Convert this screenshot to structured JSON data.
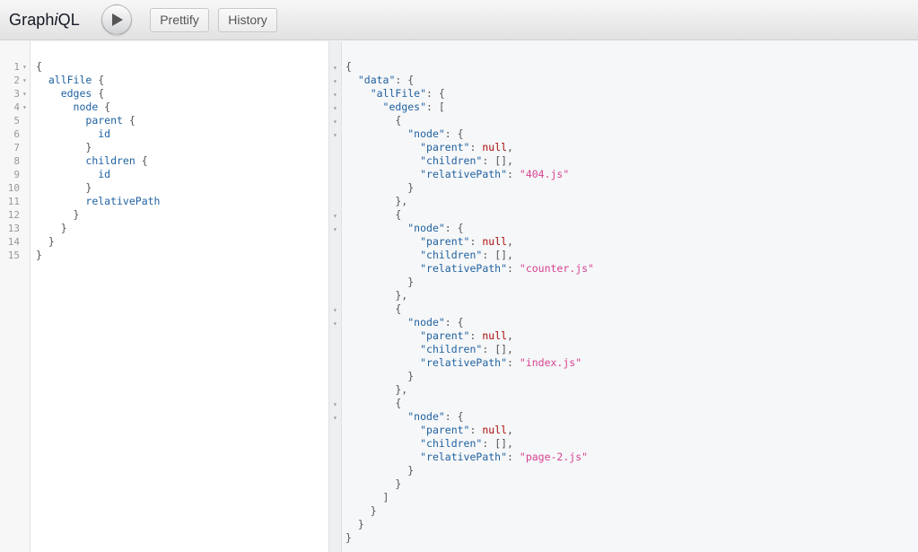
{
  "app": {
    "title_prefix": "Graph",
    "title_italic": "i",
    "title_suffix": "QL"
  },
  "toolbar": {
    "run_icon": "play-icon",
    "prettify_label": "Prettify",
    "history_label": "History"
  },
  "query_editor": {
    "line_numbers": [
      "1",
      "2",
      "3",
      "4",
      "5",
      "6",
      "7",
      "8",
      "9",
      "10",
      "11",
      "12",
      "13",
      "14",
      "15"
    ],
    "lines": [
      "{",
      "  allFile {",
      "    edges {",
      "      node {",
      "        parent {",
      "          id",
      "        }",
      "        children {",
      "          id",
      "        }",
      "        relativePath",
      "      }",
      "    }",
      "  }",
      "}"
    ]
  },
  "result": {
    "lines": [
      "{",
      "  \"data\": {",
      "    \"allFile\": {",
      "      \"edges\": [",
      "        {",
      "          \"node\": {",
      "            \"parent\": null,",
      "            \"children\": [],",
      "            \"relativePath\": \"404.js\"",
      "          }",
      "        },",
      "        {",
      "          \"node\": {",
      "            \"parent\": null,",
      "            \"children\": [],",
      "            \"relativePath\": \"counter.js\"",
      "          }",
      "        },",
      "        {",
      "          \"node\": {",
      "            \"parent\": null,",
      "            \"children\": [],",
      "            \"relativePath\": \"index.js\"",
      "          }",
      "        },",
      "        {",
      "          \"node\": {",
      "            \"parent\": null,",
      "            \"children\": [],",
      "            \"relativePath\": \"page-2.js\"",
      "          }",
      "        }",
      "      ]",
      "    }",
      "  }",
      "}"
    ]
  },
  "colors": {
    "field": "#1f61a0",
    "string": "#d64292",
    "null": "#ab0d0d",
    "punctuation": "#555555"
  }
}
